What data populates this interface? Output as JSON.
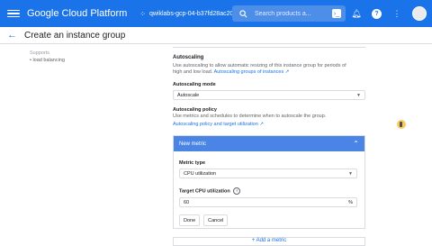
{
  "topbar": {
    "brand": "Google Cloud Platform",
    "project": "qwiklabs-gcp-04-b37fd28ac208",
    "search_placeholder": "Search products a...",
    "icons": [
      "menu-icon",
      "project-icon",
      "search-icon",
      "cloud-shell-icon",
      "notifications-icon",
      "help-icon",
      "more-vert-icon",
      "avatar"
    ]
  },
  "page": {
    "title": "Create an instance group"
  },
  "left_notes": {
    "line1": "Supports",
    "line2": "• load balancing"
  },
  "autoscaling": {
    "title": "Autoscaling",
    "desc1": "Use autoscaling to allow automatic resizing of this instance group for periods of",
    "desc2": "high and low load.",
    "desc_link": "Autoscaling groups of instances",
    "mode_label": "Autoscaling mode",
    "mode_value": "Autoscale",
    "policy_label": "Autoscaling policy",
    "policy_desc": "Use metrics and schedules to determine when to autoscale the group.",
    "policy_link": "Autoscaling policy and target utilization"
  },
  "metric": {
    "header": "New metric",
    "type_label": "Metric type",
    "type_value": "CPU utilization",
    "target_label": "Target CPU utilization",
    "target_value": "60",
    "target_unit": "%",
    "done": "Done",
    "cancel": "Cancel"
  },
  "add_metric": "+ Add a metric"
}
